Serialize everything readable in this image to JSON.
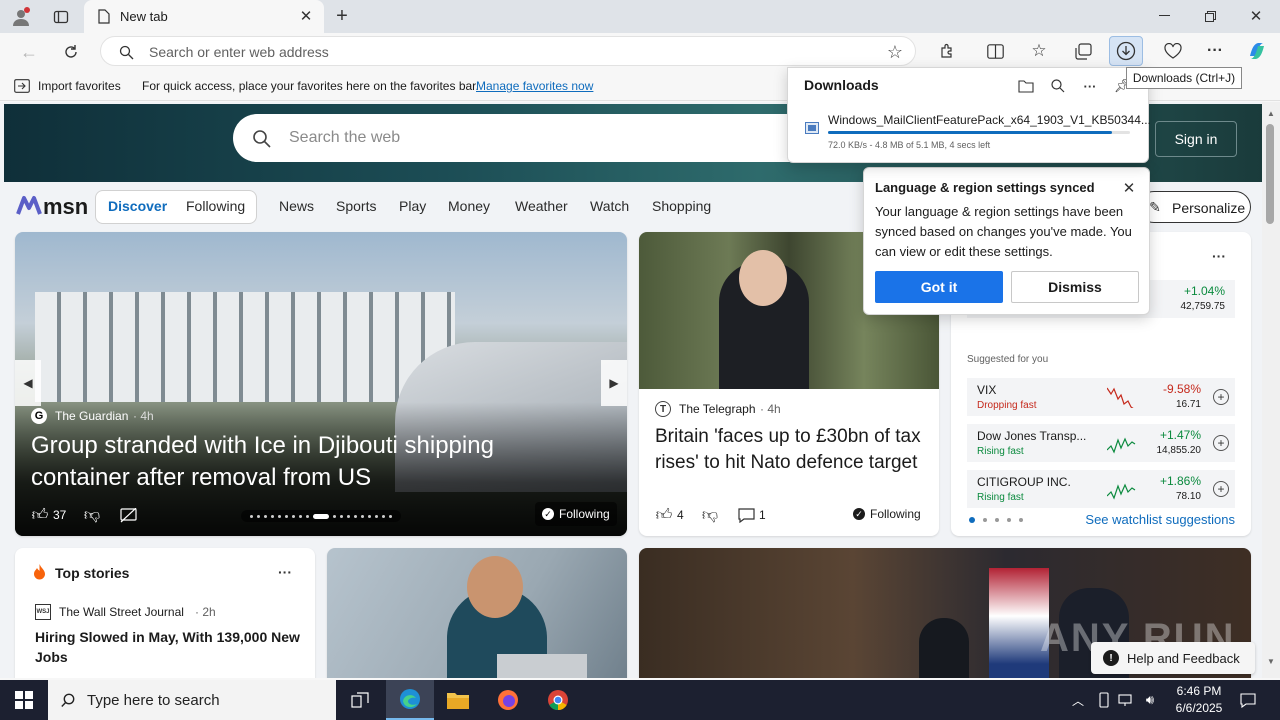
{
  "browser": {
    "tab_title": "New tab",
    "address_placeholder": "Search or enter web address",
    "tooltip_downloads": "Downloads (Ctrl+J)"
  },
  "favorites_bar": {
    "import_label": "Import favorites",
    "hint_text": "For quick access, place your favorites here on the favorites bar.",
    "manage_link": "Manage favorites now"
  },
  "downloads": {
    "title": "Downloads",
    "file_name": "Windows_MailClientFeaturePack_x64_1903_V1_KB50344...",
    "status": "72.0 KB/s - 4.8 MB of 5.1 MB, 4 secs left",
    "progress": 0.94
  },
  "msn": {
    "search_placeholder": "Search the web",
    "sign_in": "Sign in",
    "logo_text": "msn",
    "tabs": [
      "Discover",
      "Following",
      "News",
      "Sports",
      "Play",
      "Money",
      "Weather",
      "Watch",
      "Shopping"
    ],
    "personalize": "Personalize"
  },
  "toast": {
    "title": "Language & region settings synced",
    "body": "Your language & region settings have been synced based on changes you've made. You can view or edit these settings.",
    "primary": "Got it",
    "secondary": "Dismiss"
  },
  "hero_card": {
    "source": "The Guardian",
    "age": "· 4h",
    "headline": "Group stranded with Ice in Djibouti shipping container after removal from US",
    "likes": "37",
    "following": "Following"
  },
  "telegraph_card": {
    "source": "The Telegraph",
    "age": "· 4h",
    "headline": "Britain 'faces up to £30bn of tax rises' to hit Nato defence target",
    "likes": "4",
    "comments": "1",
    "following": "Following"
  },
  "watchlist": {
    "top_change": "+1.04%",
    "top_value": "42,759.75",
    "suggested_label": "Suggested for you",
    "rows": [
      {
        "name": "VIX",
        "trend": "Dropping fast",
        "change": "-9.58%",
        "value": "16.71"
      },
      {
        "name": "Dow Jones Transp...",
        "trend": "Rising fast",
        "change": "+1.47%",
        "value": "14,855.20"
      },
      {
        "name": "CITIGROUP INC.",
        "trend": "Rising fast",
        "change": "+1.86%",
        "value": "78.10"
      }
    ],
    "see_more": "See watchlist suggestions"
  },
  "top_stories": {
    "title": "Top stories",
    "source": "The Wall Street Journal",
    "age": "· 2h",
    "source_badge": "WSJ",
    "headline": "Hiring Slowed in May, With 139,000 New Jobs"
  },
  "feedback": "Help and Feedback",
  "watermark": "ANY RUN",
  "taskbar": {
    "search_placeholder": "Type here to search",
    "time": "6:46 PM",
    "date": "6/6/2025"
  },
  "colors": {
    "accent": "#0f6cbd",
    "primary_button": "#1a73e8"
  }
}
